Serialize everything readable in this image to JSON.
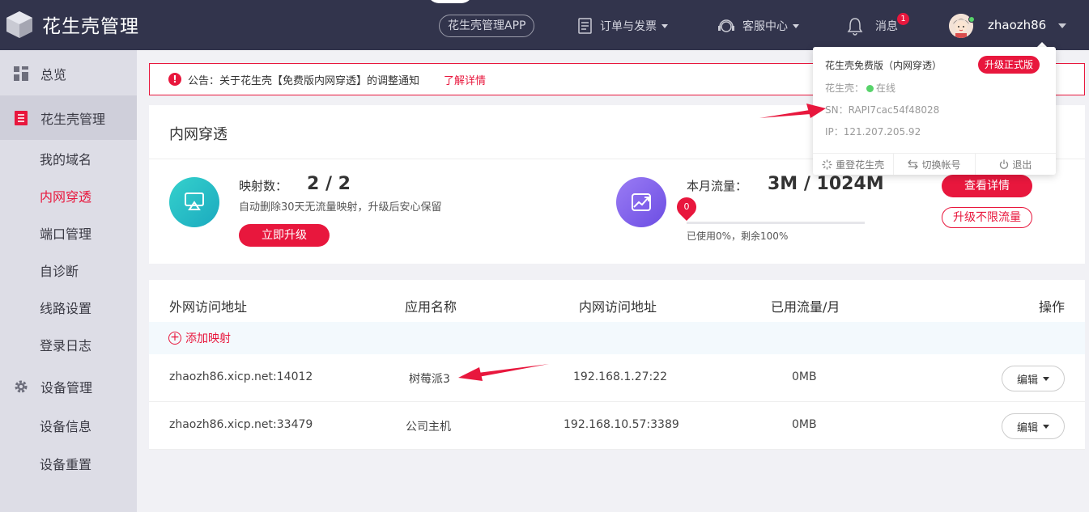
{
  "app": {
    "title": "花生壳管理"
  },
  "topnav": {
    "app_label": "花生壳管理APP",
    "orders_label": "订单与发票",
    "service_label": "客服中心",
    "messages_label": "消息",
    "messages_count": "1",
    "username": "zhaozh86"
  },
  "sidebar": {
    "overview": "总览",
    "hsk_manage": "花生壳管理",
    "items": [
      "我的域名",
      "内网穿透",
      "端口管理",
      "自诊断",
      "线路设置",
      "登录日志"
    ],
    "device_manage": "设备管理",
    "device_items": [
      "设备信息",
      "设备重置"
    ]
  },
  "notice": {
    "text": "公告：关于花生壳【免费版内网穿透】的调整通知",
    "link": "了解详情"
  },
  "card": {
    "title": "内网穿透",
    "mapping_label": "映射数：",
    "mapping_value": "2 / 2",
    "mapping_desc": "自动删除30天无流量映射，升级后安心保留",
    "upgrade_btn": "立即升级",
    "traffic_label": "本月流量：",
    "traffic_value": "3M / 1024M",
    "traffic_pin": "0",
    "traffic_used_fraction": 0,
    "traffic_desc": "已使用0%，剩余100%",
    "detail_btn": "查看详情",
    "unlimited_btn": "升级不限流量"
  },
  "table": {
    "headers": [
      "外网访问地址",
      "应用名称",
      "内网访问地址",
      "已用流量/月",
      "操作"
    ],
    "add_label": "添加映射",
    "rows": [
      {
        "external": "zhaozh86.xicp.net:14012",
        "app": "树莓派3",
        "internal": "192.168.1.27:22",
        "traffic": "0MB",
        "action": "编辑"
      },
      {
        "external": "zhaozh86.xicp.net:33479",
        "app": "公司主机",
        "internal": "192.168.10.57:3389",
        "traffic": "0MB",
        "action": "编辑"
      }
    ]
  },
  "popup": {
    "title": "花生壳免费版（内网穿透）",
    "upgrade": "升级正式版",
    "status_label": "花生壳：",
    "status_value": "在线",
    "sn": "SN：RAPI7cac54f48028",
    "ip": "IP：121.207.205.92",
    "footer": [
      "重登花生壳",
      "切换帐号",
      "退出"
    ]
  },
  "colors": {
    "accent": "#e8173d",
    "topbar": "#32344c",
    "sidebar": "#dddde6",
    "online": "#57d36a"
  }
}
